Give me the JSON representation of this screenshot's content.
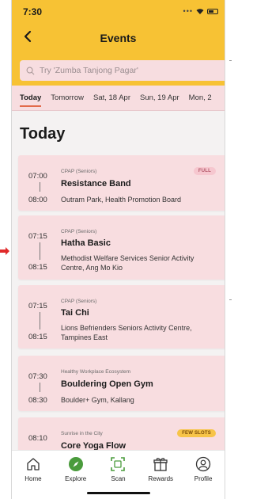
{
  "status": {
    "time": "7:30"
  },
  "header": {
    "title": "Events",
    "back_label": "‹"
  },
  "search": {
    "placeholder": "Try 'Zumba Tanjong Pagar'"
  },
  "tabs": [
    {
      "label": "Today",
      "active": true
    },
    {
      "label": "Tomorrow"
    },
    {
      "label": "Sat, 18 Apr"
    },
    {
      "label": "Sun, 19 Apr"
    },
    {
      "label": "Mon, 2"
    }
  ],
  "section": {
    "title": "Today"
  },
  "events": [
    {
      "start": "07:00",
      "end": "08:00",
      "org": "CPAP (Seniors)",
      "name": "Resistance Band",
      "location": "Outram Park, Health Promotion Board",
      "badge": "FULL"
    },
    {
      "start": "07:15",
      "end": "08:15",
      "org": "CPAP (Seniors)",
      "name": "Hatha Basic",
      "location": "Methodist Welfare Services Senior Activity Centre, Ang Mo Kio",
      "badge": ""
    },
    {
      "start": "07:15",
      "end": "08:15",
      "org": "CPAP (Seniors)",
      "name": "Tai Chi",
      "location": "Lions Befrienders Seniors Activity Centre, Tampines East",
      "badge": ""
    },
    {
      "start": "07:30",
      "end": "08:30",
      "org": "Healthy Workplace Ecosystem",
      "name": "Bouldering Open Gym",
      "location": "Boulder+ Gym, Kallang",
      "badge": ""
    },
    {
      "start": "08:10",
      "end": "",
      "org": "Sunrise in the City",
      "name": "Core Yoga Flow",
      "location": "",
      "badge": "FEW SLOTS"
    }
  ],
  "nav": [
    {
      "label": "Home",
      "icon": "home-icon"
    },
    {
      "label": "Explore",
      "icon": "compass-icon"
    },
    {
      "label": "Scan",
      "icon": "scan-icon"
    },
    {
      "label": "Rewards",
      "icon": "gift-icon"
    },
    {
      "label": "Profile",
      "icon": "profile-icon"
    }
  ],
  "colors": {
    "brand_yellow": "#f7c234",
    "card_pink": "#f8dde0",
    "accent": "#e26a4a",
    "explore_green": "#4a9b3c"
  }
}
